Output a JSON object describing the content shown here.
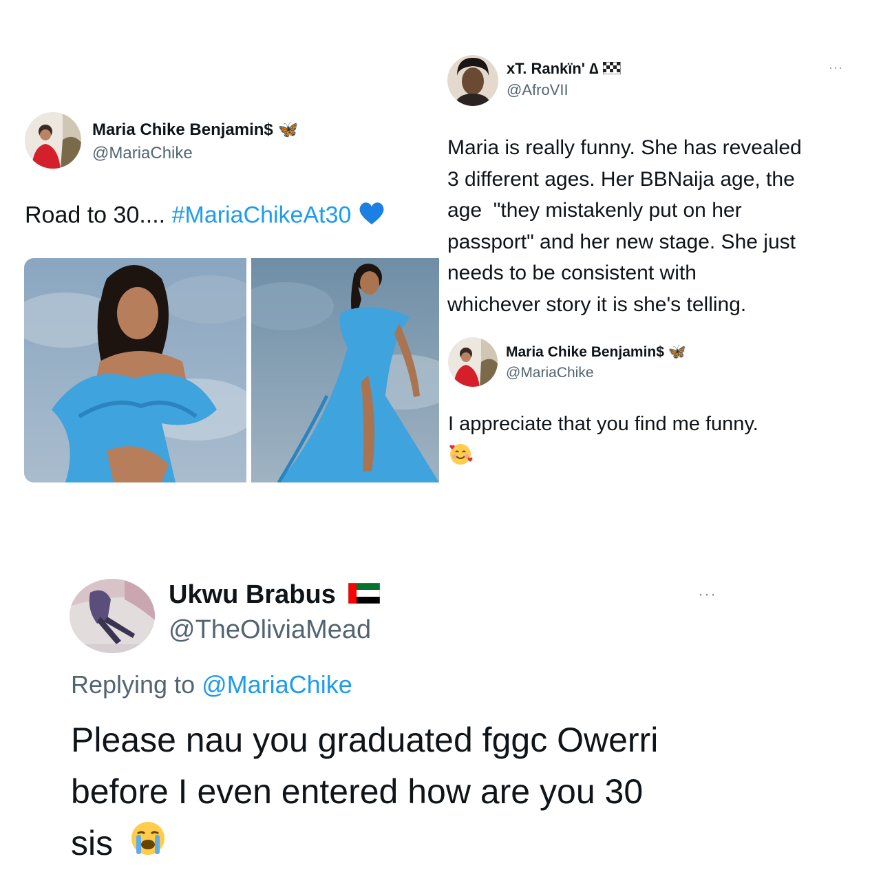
{
  "tweet_left": {
    "name": "Maria Chike Benjamin$",
    "badge": "🦋",
    "handle": "@MariaChike",
    "text_prefix": "Road to 30.... ",
    "hashtag": "#MariaChikeAt30",
    "heart": "💙"
  },
  "tweet_right": {
    "name": "xT. Rankïn' ∆",
    "flag": "🏁",
    "handle": "@AfroVII",
    "more": "···",
    "body_lines": [
      "Maria is really funny. She has revealed",
      "3 different ages. Her BBNaija age, the",
      "age  \"they mistakenly put on her",
      "passport\" and her new stage. She just",
      "needs to be consistent with",
      "whichever story it is she's telling."
    ]
  },
  "reply_maria": {
    "name": "Maria Chike Benjamin$",
    "badge": "🦋",
    "handle": "@MariaChike",
    "text": "I appreciate that you find me funny.",
    "emoji": "🥰"
  },
  "tweet_bottom": {
    "name": "Ukwu Brabus",
    "handle": "@TheOliviaMead",
    "more": "···",
    "replying_prefix": "Replying to ",
    "replying_handle": "@MariaChike",
    "body_lines": [
      "Please nau you graduated fggc Owerri",
      "before I even entered how are you 30",
      "sis"
    ],
    "emoji": "😭"
  },
  "colors": {
    "link": "#1d9bf0",
    "secondary_text": "#536471",
    "dress_blue": "#3fa3dd"
  }
}
